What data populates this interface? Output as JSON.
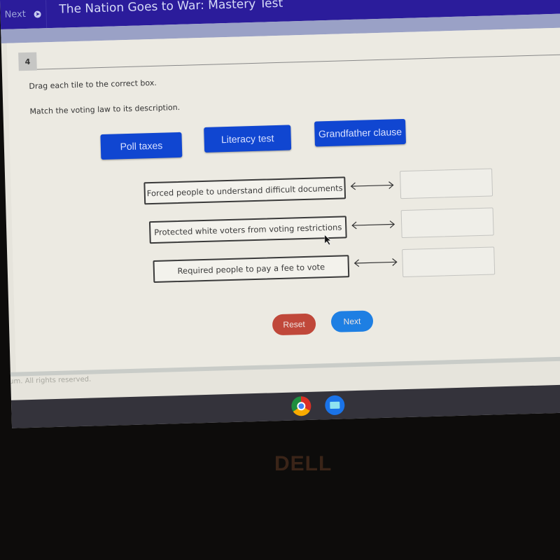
{
  "topbar": {
    "next_label": "Next",
    "next_icon": "arrow-circle-right-icon",
    "title": "The Nation Goes to War: Mastery Test"
  },
  "question": {
    "number": "4",
    "instruction": "Drag each tile to the correct box.",
    "prompt": "Match the voting law to its description."
  },
  "tiles": [
    {
      "label": "Poll taxes"
    },
    {
      "label": "Literacy test"
    },
    {
      "label": "Grandfather clause"
    }
  ],
  "pairs": [
    {
      "description": "Forced people to understand difficult documents",
      "answer": ""
    },
    {
      "description": "Protected white voters from voting restrictions",
      "answer": ""
    },
    {
      "description": "Required people to pay a fee to vote",
      "answer": ""
    }
  ],
  "buttons": {
    "reset_label": "Reset",
    "next_label": "Next"
  },
  "colors": {
    "header": "#2b1c9b",
    "tile": "#1046d1",
    "reset": "#c0483a",
    "next": "#1e7fe3"
  },
  "footer": {
    "copyright": "um. All rights reserved."
  },
  "shelf": {
    "apps": [
      {
        "name": "Chrome",
        "icon": "chrome-icon"
      },
      {
        "name": "Files",
        "icon": "folder-icon"
      }
    ]
  },
  "hardware": {
    "brand_logo": "DELL"
  }
}
